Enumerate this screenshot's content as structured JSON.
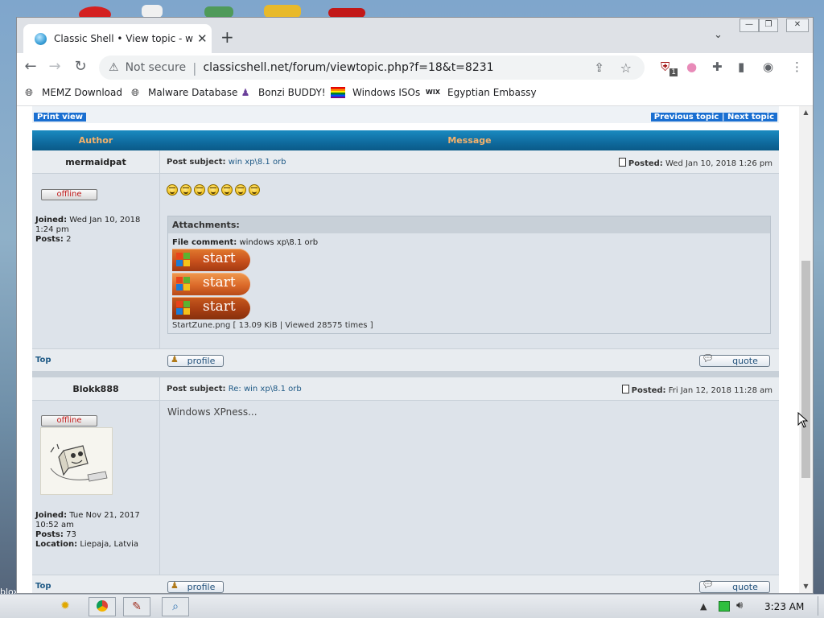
{
  "browser": {
    "tab_title": "Classic Shell • View topic - win xp\\8.1 orb",
    "tab_close": "✕",
    "new_tab": "+",
    "tab_search": "⌄",
    "security_label": "Not secure",
    "url": "classicshell.net/forum/viewtopic.php?f=18&t=8231",
    "extension_badge": "1",
    "window_controls": [
      "—",
      "❐",
      "✕"
    ]
  },
  "bookmarks": [
    {
      "label": "MEMZ Download",
      "icon": "globe-icon"
    },
    {
      "label": "Malware Database",
      "icon": "globe-icon"
    },
    {
      "label": "Bonzi BUDDY!",
      "icon": "bonzi-icon"
    },
    {
      "label": "Windows ISOs",
      "icon": "rainbow-flag-icon"
    },
    {
      "label": "Egyptian Embassy",
      "icon": "wix-icon",
      "badge": "WIX"
    }
  ],
  "forum": {
    "print_view": "Print view",
    "previous_topic": "Previous topic",
    "pipe": "|",
    "next_topic": "Next topic",
    "col_author": "Author",
    "col_message": "Message",
    "subject_label": "Post subject:",
    "posted_label": "Posted:",
    "top_label": "Top",
    "profile_label": "profile",
    "quote_label": "quote",
    "offline_label": "offline",
    "posts": [
      {
        "author": "mermaidpat",
        "subject": "win xp\\8.1 orb",
        "posted": "Wed Jan 10, 2018 1:26 pm",
        "joined_label": "Joined:",
        "joined": "Wed Jan 10, 2018 1:24 pm",
        "posts_label": "Posts:",
        "posts_count": "2",
        "smiley_count": 7,
        "attachments_title": "Attachments:",
        "file_comment_label": "File comment:",
        "file_comment": "windows xp\\8.1 orb",
        "start_label": "start",
        "file_info": "StartZune.png [ 13.09 KiB | Viewed 28575 times ]"
      },
      {
        "author": "Blokk888",
        "subject": "Re: win xp\\8.1 orb",
        "posted": "Fri Jan 12, 2018 11:28 am",
        "message": "Windows XPness...",
        "joined_label": "Joined:",
        "joined": "Tue Nov 21, 2017 10:52 am",
        "posts_label": "Posts:",
        "posts_count": "73",
        "location_label": "Location:",
        "location": "Liepaja, Latvia"
      }
    ]
  },
  "taskbar": {
    "clock": "3:23 AM"
  },
  "desktop": {
    "corner_text": "bloxxery\nanety"
  },
  "colors": {
    "header_gradient": "#0f6b9e",
    "header_text": "#f6b26b",
    "link": "#1f5a86",
    "offline": "#c01818",
    "start_orange": "#c8501c"
  }
}
